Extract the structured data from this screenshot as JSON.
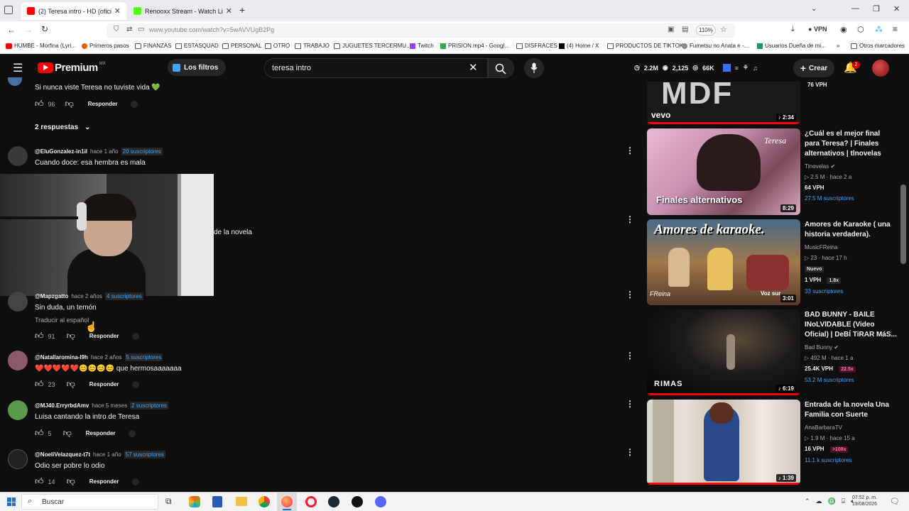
{
  "browser": {
    "tabs": [
      {
        "title": "(2) Teresa intro - HD (oficial) - Y",
        "color": "#ff0000"
      },
      {
        "title": "Renooxx Stream - Watch Live o",
        "color": "#53fc18"
      }
    ],
    "url": "www.youtube.com/watch?v=5wAVVUgB2Pg",
    "zoom": "110%",
    "vpn": "VPN",
    "bookmarks": [
      "HUMBE - Morfina (Lyri...",
      "Primeros pasos",
      "FINANZAS",
      "ESTASQUAD",
      "PERSONAL",
      "OTRO",
      "TRABAJO",
      "JUGUETES TERCERMU...",
      "Twitch",
      "PRISION.mp4 - Googl...",
      "DISFRACES",
      "(4) Home / X",
      "PRODUCTOS DE TIKTOK",
      "Fumetsu no Anata e -...",
      "Usuarios Dueña de mi...",
      "Otros marcadores"
    ]
  },
  "youtube": {
    "logo": "Premium",
    "region": "MX",
    "filters": "Los filtros",
    "search_value": "teresa intro",
    "stats": {
      "subs": "2.2M",
      "views": "2,125",
      "watch": "66K"
    },
    "create": "Crear",
    "notif_count": "2"
  },
  "comments": [
    {
      "text": "Si nunca viste Teresa no tuviste vida 💚",
      "likes": "96",
      "reply_label": "Responder",
      "replies_toggle": "2 respuestas"
    },
    {
      "handle": "@EluGonzalez-in1il",
      "time": "hace 1 año",
      "subs": "20 suscriptores",
      "text": "Cuando doce: esa hembra es mala"
    },
    {
      "text_partial": "de la novela"
    },
    {
      "handle": "@Mapzgatto",
      "time": "hace 2 años",
      "subs": "4 suscriptores",
      "text": "Sin duda, un temón",
      "translate": "Traducir al español",
      "likes": "91",
      "reply_label": "Responder"
    },
    {
      "handle": "@Natallaromina-I9h",
      "time": "hace 2 años",
      "subs": "5 suscriptores",
      "text": "❤️❤️❤️❤️❤️😊😊😊😊 que hermosaaaaaaa",
      "likes": "23",
      "reply_label": "Responder"
    },
    {
      "handle": "@MJ40.ErryrbdAmv",
      "time": "hace 5 meses",
      "subs": "2 suscriptores",
      "text": "Luisa cantando la intro de Teresa",
      "likes": "5",
      "reply_label": "Responder"
    },
    {
      "handle": "@NoeliVelazquez-t7t",
      "time": "hace 1 año",
      "subs": "57 suscriptores",
      "text": "Odio ser pobre lo odio",
      "likes": "14",
      "reply_label": "Responder"
    }
  ],
  "sidebar": [
    {
      "thumb_text": "MDF",
      "logo": "vevo",
      "duration": "2:34",
      "vph": "76 VPH"
    },
    {
      "title": "¿Cuál es el mejor final para Teresa? | Finales alternativos | tlnovelas",
      "channel": "Tlnovelas",
      "views": "2.5 M",
      "age": "hace 2 a",
      "vph": "64 VPH",
      "subs": "27.5 M suscriptores",
      "duration": "8:29",
      "thumb_text": "Finales alternativos",
      "thumb_brand": "Teresa"
    },
    {
      "title": "Amores de Karaoke ( una historia verdadera).",
      "channel": "MusicFReina",
      "views": "23",
      "age": "hace 17 h",
      "new": "Nuevo",
      "vph": "1 VPH",
      "ratio": "1.8x",
      "subs": "33 suscriptores",
      "duration": "3:01",
      "thumb_text": "Amores de karaoke.",
      "thumb_sign": "FReina",
      "thumb_extra": "Voz sur"
    },
    {
      "title": "BAD BUNNY - BAILE INoLVIDABLE (Video Oficial) | DeBÍ TiRAR MáS...",
      "channel": "Bad Bunny",
      "views": "492 M",
      "age": "hace 1 a",
      "vph": "25.4K VPH",
      "ratio": "22.5x",
      "subs": "53.2 M suscriptores",
      "duration": "6:19",
      "thumb_text": "RIMAS"
    },
    {
      "title": "Entrada de la novela Una Familia con Suerte",
      "channel": "AnaBarbaraTV",
      "views": "1.9 M",
      "age": "hace 15 a",
      "vph": "16 VPH",
      "ratio": ">100x",
      "subs": "11.1 k suscriptores",
      "duration": "1:39"
    }
  ],
  "taskbar": {
    "search": "Buscar",
    "time": "07:52 p. m.",
    "date": "19/08/2026"
  },
  "colors": {
    "bg": "#0f0f0f",
    "accent": "#ff0000",
    "link": "#3ea6ff"
  }
}
